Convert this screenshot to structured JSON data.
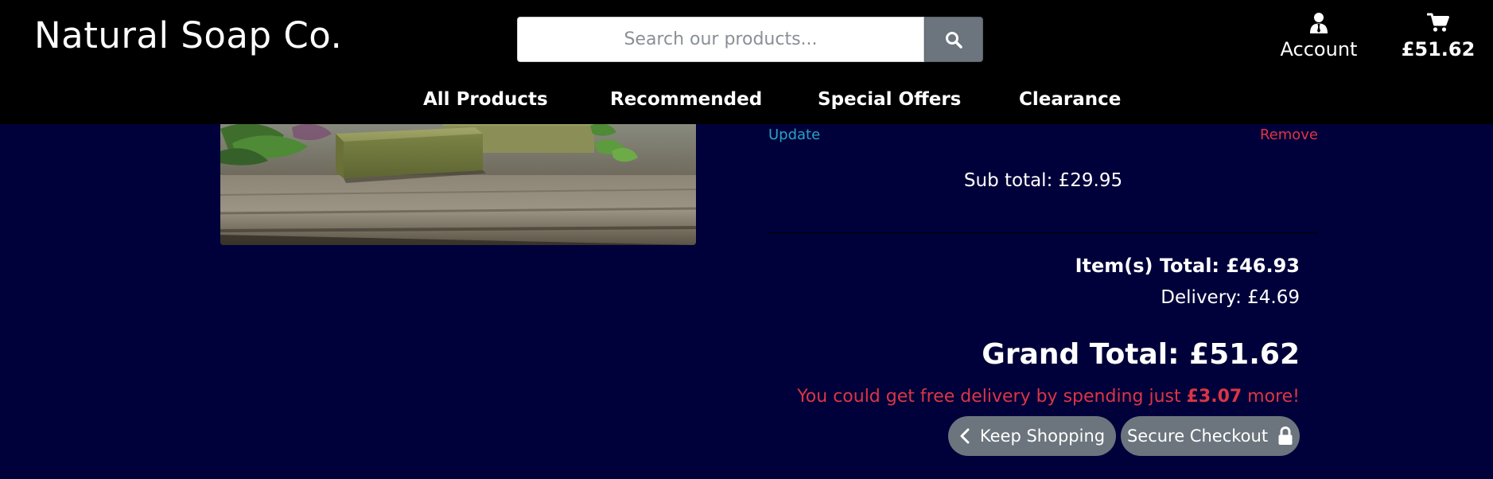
{
  "header": {
    "brand": "Natural Soap Co.",
    "search": {
      "placeholder": "Search our products...",
      "value": ""
    },
    "account_label": "Account",
    "cart_total": "£51.62"
  },
  "nav": {
    "items": [
      {
        "label": "All Products"
      },
      {
        "label": "Recommended"
      },
      {
        "label": "Special Offers"
      },
      {
        "label": "Clearance"
      }
    ]
  },
  "bag_item": {
    "update_label": "Update",
    "remove_label": "Remove",
    "subtotal": "Sub total: £29.95"
  },
  "summary": {
    "items_total": "Item(s) Total: £46.93",
    "delivery": "Delivery: £4.69",
    "grand_total": "Grand Total: £51.62",
    "free_delivery_prefix": "You could get free delivery by spending just ",
    "free_delivery_amount": "£3.07",
    "free_delivery_suffix": " more!"
  },
  "buttons": {
    "keep_shopping": "Keep Shopping",
    "secure_checkout": "Secure Checkout"
  },
  "icons": {
    "search": "search-icon",
    "account": "user-icon",
    "cart": "shopping-cart-icon",
    "back": "chevron-left-icon",
    "lock": "lock-icon"
  },
  "colors": {
    "page_background": "#00003a",
    "header_background": "#000000",
    "link_blue": "#27a3c8",
    "danger_red": "#dc3545",
    "button_grey": "#6c757d"
  }
}
